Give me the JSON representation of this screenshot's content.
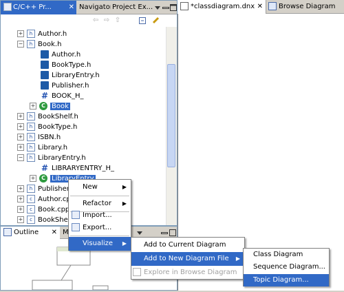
{
  "left_panel": {
    "tabs": [
      {
        "label": "C/C++ Pr..."
      },
      {
        "label": "Navigator"
      },
      {
        "label": "Project Ex..."
      }
    ],
    "tree": [
      {
        "label": "Author.h",
        "icon": "header-file-icon"
      },
      {
        "label": "Book.h",
        "icon": "header-file-icon"
      },
      {
        "label": "Author.h",
        "icon": "include-icon"
      },
      {
        "label": "BookType.h",
        "icon": "include-icon"
      },
      {
        "label": "LibraryEntry.h",
        "icon": "include-icon"
      },
      {
        "label": "Publisher.h",
        "icon": "include-icon"
      },
      {
        "label": "BOOK_H_",
        "icon": "macro-icon"
      },
      {
        "label": "Book",
        "icon": "class-icon"
      },
      {
        "label": "BookShelf.h",
        "icon": "header-file-icon"
      },
      {
        "label": "BookType.h",
        "icon": "header-file-icon"
      },
      {
        "label": "ISBN.h",
        "icon": "header-file-icon"
      },
      {
        "label": "Library.h",
        "icon": "header-file-icon"
      },
      {
        "label": "LibraryEntry.h",
        "icon": "header-file-icon"
      },
      {
        "label": "LIBRARYENTRY_H_",
        "icon": "macro-icon"
      },
      {
        "label": "LibraryEntry",
        "icon": "class-icon"
      },
      {
        "label": "Publisher.h",
        "icon": "header-file-icon"
      },
      {
        "label": "Author.cpp",
        "icon": "source-file-icon"
      },
      {
        "label": "Book.cpp",
        "icon": "source-file-icon"
      },
      {
        "label": "BookShelf.cpp",
        "icon": "source-file-icon"
      }
    ]
  },
  "outline_panel": {
    "tabs": [
      {
        "label": "Outline"
      },
      {
        "label": "Ma"
      }
    ]
  },
  "editor": {
    "tabs": [
      {
        "label": "*classdiagram.dnx"
      },
      {
        "label": "Browse Diagram"
      }
    ]
  },
  "context_menu": {
    "items": [
      {
        "label": "New",
        "submenu": true
      },
      {
        "label": "Refactor",
        "submenu": true
      },
      {
        "label": "Import..."
      },
      {
        "label": "Export..."
      },
      {
        "label": "Visualize",
        "submenu": true
      }
    ]
  },
  "visualize_menu": {
    "items": [
      {
        "label": "Add to Current Diagram"
      },
      {
        "label": "Add to New Diagram File",
        "submenu": true
      },
      {
        "label": "Explore in Browse Diagram"
      }
    ]
  },
  "diagram_menu": {
    "items": [
      {
        "label": "Class Diagram"
      },
      {
        "label": "Sequence Diagram..."
      },
      {
        "label": "Topic Diagram..."
      }
    ]
  },
  "colors": {
    "selection": "#3169c6",
    "active_tab": "#3169c6"
  }
}
